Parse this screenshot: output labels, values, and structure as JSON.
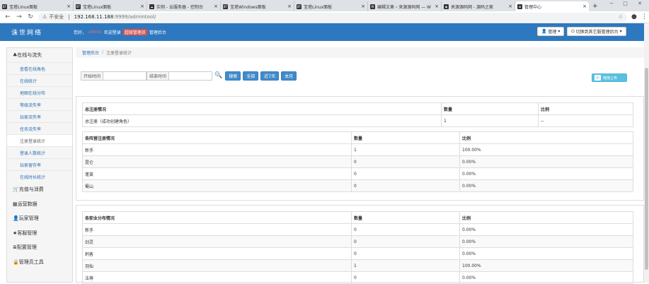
{
  "browser": {
    "tabs": [
      {
        "title": "宝塔Linux面板",
        "icon": "bt-icon"
      },
      {
        "title": "宝塔Linux面板",
        "icon": "bt-icon"
      },
      {
        "title": "实例 - 云服务器 - 控制台",
        "icon": "cloud-icon"
      },
      {
        "title": "宝塔Windows面板",
        "icon": "bt-icon"
      },
      {
        "title": "宝塔Linux面板",
        "icon": "bt-icon"
      },
      {
        "title": "编辑文章 ‹ 来源源码网 — W",
        "icon": "wordpress-icon"
      },
      {
        "title": "来源源码网 - 源码之家",
        "icon": "globe-icon"
      },
      {
        "title": "管理中心",
        "icon": "leaf-icon"
      }
    ],
    "new_tab": "+",
    "url_warning": "不安全",
    "url_host": "192.168.11.188",
    "url_path": ":9999/admintool/"
  },
  "header": {
    "logo": "诛世网络",
    "greeting": "您好，",
    "username": "admin",
    "welcome": "欢迎登录",
    "role": "超级管理员",
    "backend": "管理后台",
    "manage_btn": "管理",
    "switch_btn": "切换到其它服管理后台"
  },
  "sidebar": {
    "groups_top": [
      {
        "label": "在线与流失"
      }
    ],
    "items": [
      {
        "label": "查看在线角色"
      },
      {
        "label": "在线统计"
      },
      {
        "label": "地图在线分布"
      },
      {
        "label": "等级流失率"
      },
      {
        "label": "玩家流失率"
      },
      {
        "label": "任务流失率"
      },
      {
        "label": "注册登录统计",
        "active": true
      },
      {
        "label": "登录人数统计"
      },
      {
        "label": "玩家留存率"
      },
      {
        "label": "在线时长统计"
      }
    ],
    "groups_bottom": [
      {
        "label": "充值与消费",
        "icon": "cart-icon"
      },
      {
        "label": "运营数据",
        "icon": "chart-icon"
      },
      {
        "label": "玩家管理",
        "icon": "user-icon"
      },
      {
        "label": "客服管理",
        "icon": "star-icon"
      },
      {
        "label": "配置管理",
        "icon": "list-icon"
      },
      {
        "label": "管理员工具",
        "icon": "lock-icon"
      }
    ]
  },
  "breadcrumb": {
    "home": "管理后台",
    "sep": "/",
    "current": "注册登录统计"
  },
  "filter": {
    "start_label": "开始时间",
    "end_label": "结束时间",
    "buttons": [
      "搜索",
      "全部",
      "近7天",
      "本月"
    ],
    "upload_btn": "拖拽上传"
  },
  "summary_table": {
    "headers": [
      "总注册情况",
      "数量",
      "比例"
    ],
    "rows": [
      [
        "总注册（成功创建角色）",
        "1",
        "--"
      ]
    ]
  },
  "camp_table": {
    "headers": [
      "各阵营注册情况",
      "数量",
      "比例"
    ],
    "rows": [
      [
        "新手",
        "1",
        "100.00%"
      ],
      [
        "昆仑",
        "0",
        "0.00%"
      ],
      [
        "蓬莱",
        "0",
        "0.00%"
      ],
      [
        "蜀山",
        "0",
        "0.00%"
      ]
    ]
  },
  "job_table": {
    "headers": [
      "各职业分布情况",
      "数量",
      "比例"
    ],
    "rows": [
      [
        "新手",
        "0",
        "0.00%"
      ],
      [
        "剑灵",
        "0",
        "0.00%"
      ],
      [
        "刺客",
        "0",
        "0.00%"
      ],
      [
        "羽仙",
        "1",
        "100.00%"
      ],
      [
        "法尊",
        "0",
        "0.00%"
      ]
    ]
  }
}
